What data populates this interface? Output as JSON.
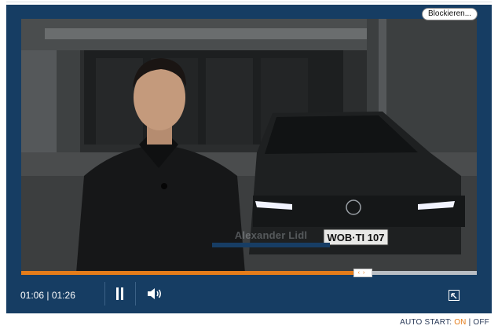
{
  "player": {
    "block_label": "Blockieren...",
    "lower_third_name": "Alexander Lidl",
    "license_plate": "WOB·TI 107",
    "progress_fraction": 0.75,
    "current_time": "01:06",
    "separator": "|",
    "duration": "01:26",
    "pause_icon": "pause-icon",
    "volume_icon": "volume-icon",
    "expand_icon": "expand-icon",
    "handle_glyphs": "‹›",
    "colors": {
      "frame": "#163d63",
      "accent": "#e47c1a",
      "track": "#b9bec4"
    }
  },
  "autostart": {
    "label": "AUTO START:",
    "on": "ON",
    "separator": "|",
    "off": "OFF"
  }
}
